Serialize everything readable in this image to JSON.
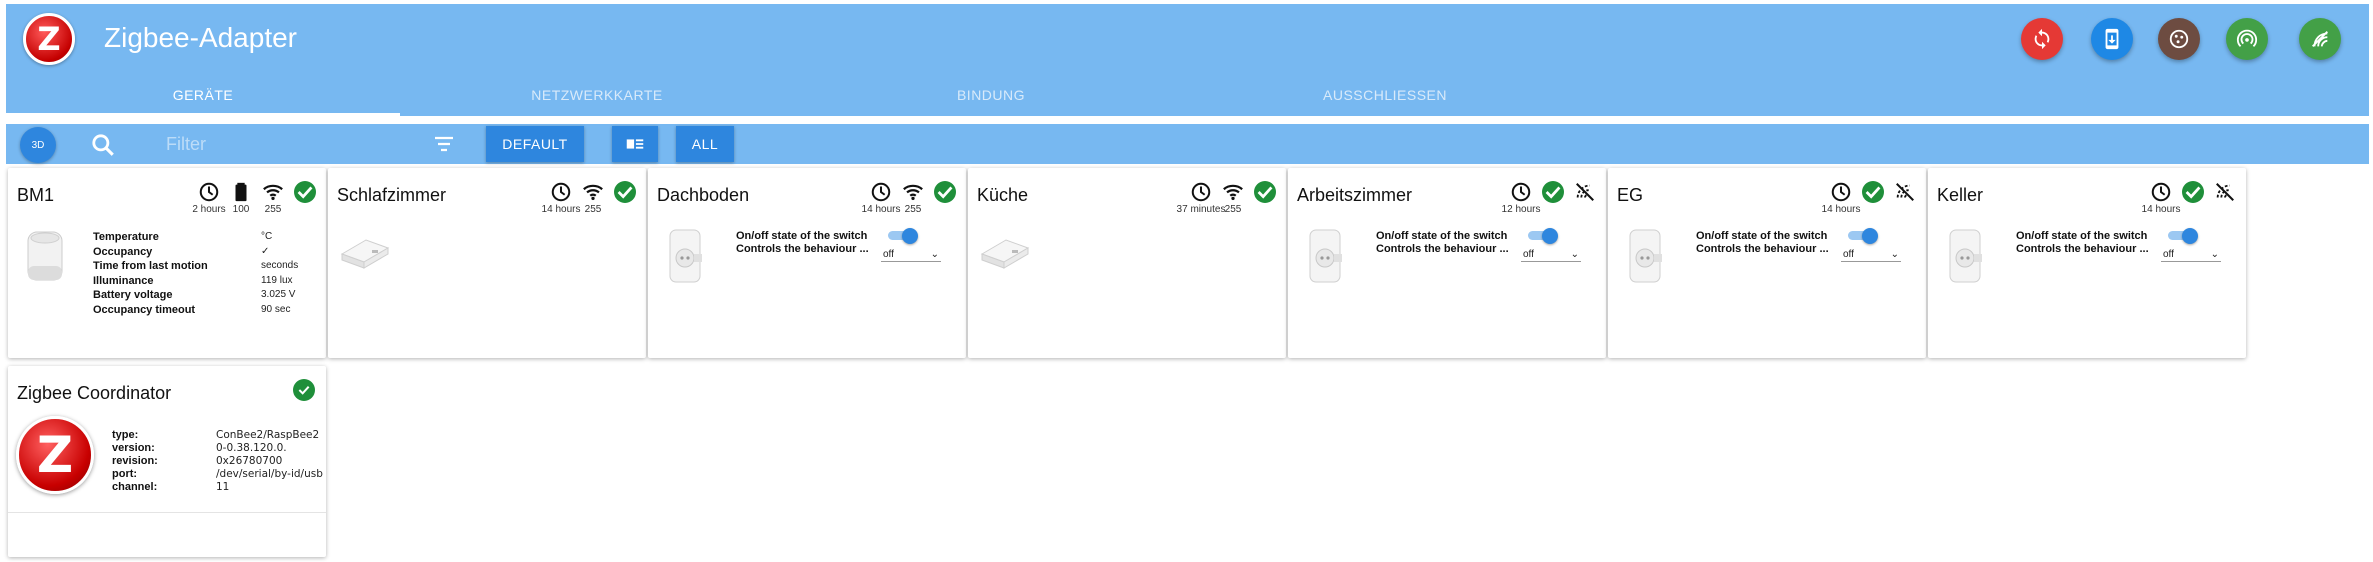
{
  "app": {
    "title": "Zigbee-Adapter",
    "logo_letter": "Z"
  },
  "actions": [
    {
      "name": "reset-button",
      "icon": "refresh-icon",
      "color": "#e53935"
    },
    {
      "name": "join-device-button",
      "icon": "phone-download-icon",
      "color": "#1e88e5"
    },
    {
      "name": "map-button",
      "icon": "cookie-icon",
      "color": "#6d4c41"
    },
    {
      "name": "pairing-button",
      "icon": "broadcast-icon",
      "color": "#43a047"
    },
    {
      "name": "touchlink-button",
      "icon": "signal-icon",
      "color": "#43a047"
    }
  ],
  "tabs": [
    {
      "label": "Geräte",
      "active": true
    },
    {
      "label": "Netzwerkkarte",
      "active": false
    },
    {
      "label": "Bindung",
      "active": false
    },
    {
      "label": "Ausschließen",
      "active": false
    }
  ],
  "toolbar": {
    "view3d_label": "3D",
    "filter_placeholder": "Filter",
    "default_label": "DEFAULT",
    "all_label": "ALL"
  },
  "colors": {
    "appbar": "#77b8f1",
    "accent": "#2e86de",
    "ok": "#1f8f3a"
  },
  "devices": [
    {
      "name": "BM1",
      "last_seen": "2 hours",
      "battery": "100",
      "link": "255",
      "states": [
        {
          "label": "Temperature",
          "value": "°C"
        },
        {
          "label": "Occupancy",
          "value": "✓"
        },
        {
          "label": "Time from last motion",
          "value": "seconds"
        },
        {
          "label": "Illuminance",
          "value": "119 lux"
        },
        {
          "label": "Battery voltage",
          "value": "3.025 V"
        },
        {
          "label": "Occupancy timeout",
          "value": "90 sec"
        }
      ]
    },
    {
      "name": "Schlafzimmer",
      "last_seen": "14 hours",
      "link": "255"
    },
    {
      "name": "Dachboden",
      "last_seen": "14 hours",
      "link": "255",
      "switch_label": "On/off state of the switch",
      "behaviour_label": "Controls the behaviour ...",
      "select_value": "off"
    },
    {
      "name": "Küche",
      "last_seen": "37 minutes",
      "link": "255"
    },
    {
      "name": "Arbeitszimmer",
      "last_seen": "12 hours",
      "switch_label": "On/off state of the switch",
      "behaviour_label": "Controls the behaviour ...",
      "select_value": "off"
    },
    {
      "name": "EG",
      "last_seen": "14 hours",
      "switch_label": "On/off state of the switch",
      "behaviour_label": "Controls the behaviour ...",
      "select_value": "off"
    },
    {
      "name": "Keller",
      "last_seen": "14 hours",
      "switch_label": "On/off state of the switch",
      "behaviour_label": "Controls the behaviour ...",
      "select_value": "off"
    }
  ],
  "coordinator": {
    "name": "Zigbee Coordinator",
    "info": [
      {
        "label": "type:",
        "value": "ConBee2/RaspBee2"
      },
      {
        "label": "version:",
        "value": "0-0.38.120.0."
      },
      {
        "label": "revision:",
        "value": "0x26780700"
      },
      {
        "label": "port:",
        "value": "/dev/serial/by-id/usb"
      },
      {
        "label": "channel:",
        "value": "11"
      }
    ]
  }
}
